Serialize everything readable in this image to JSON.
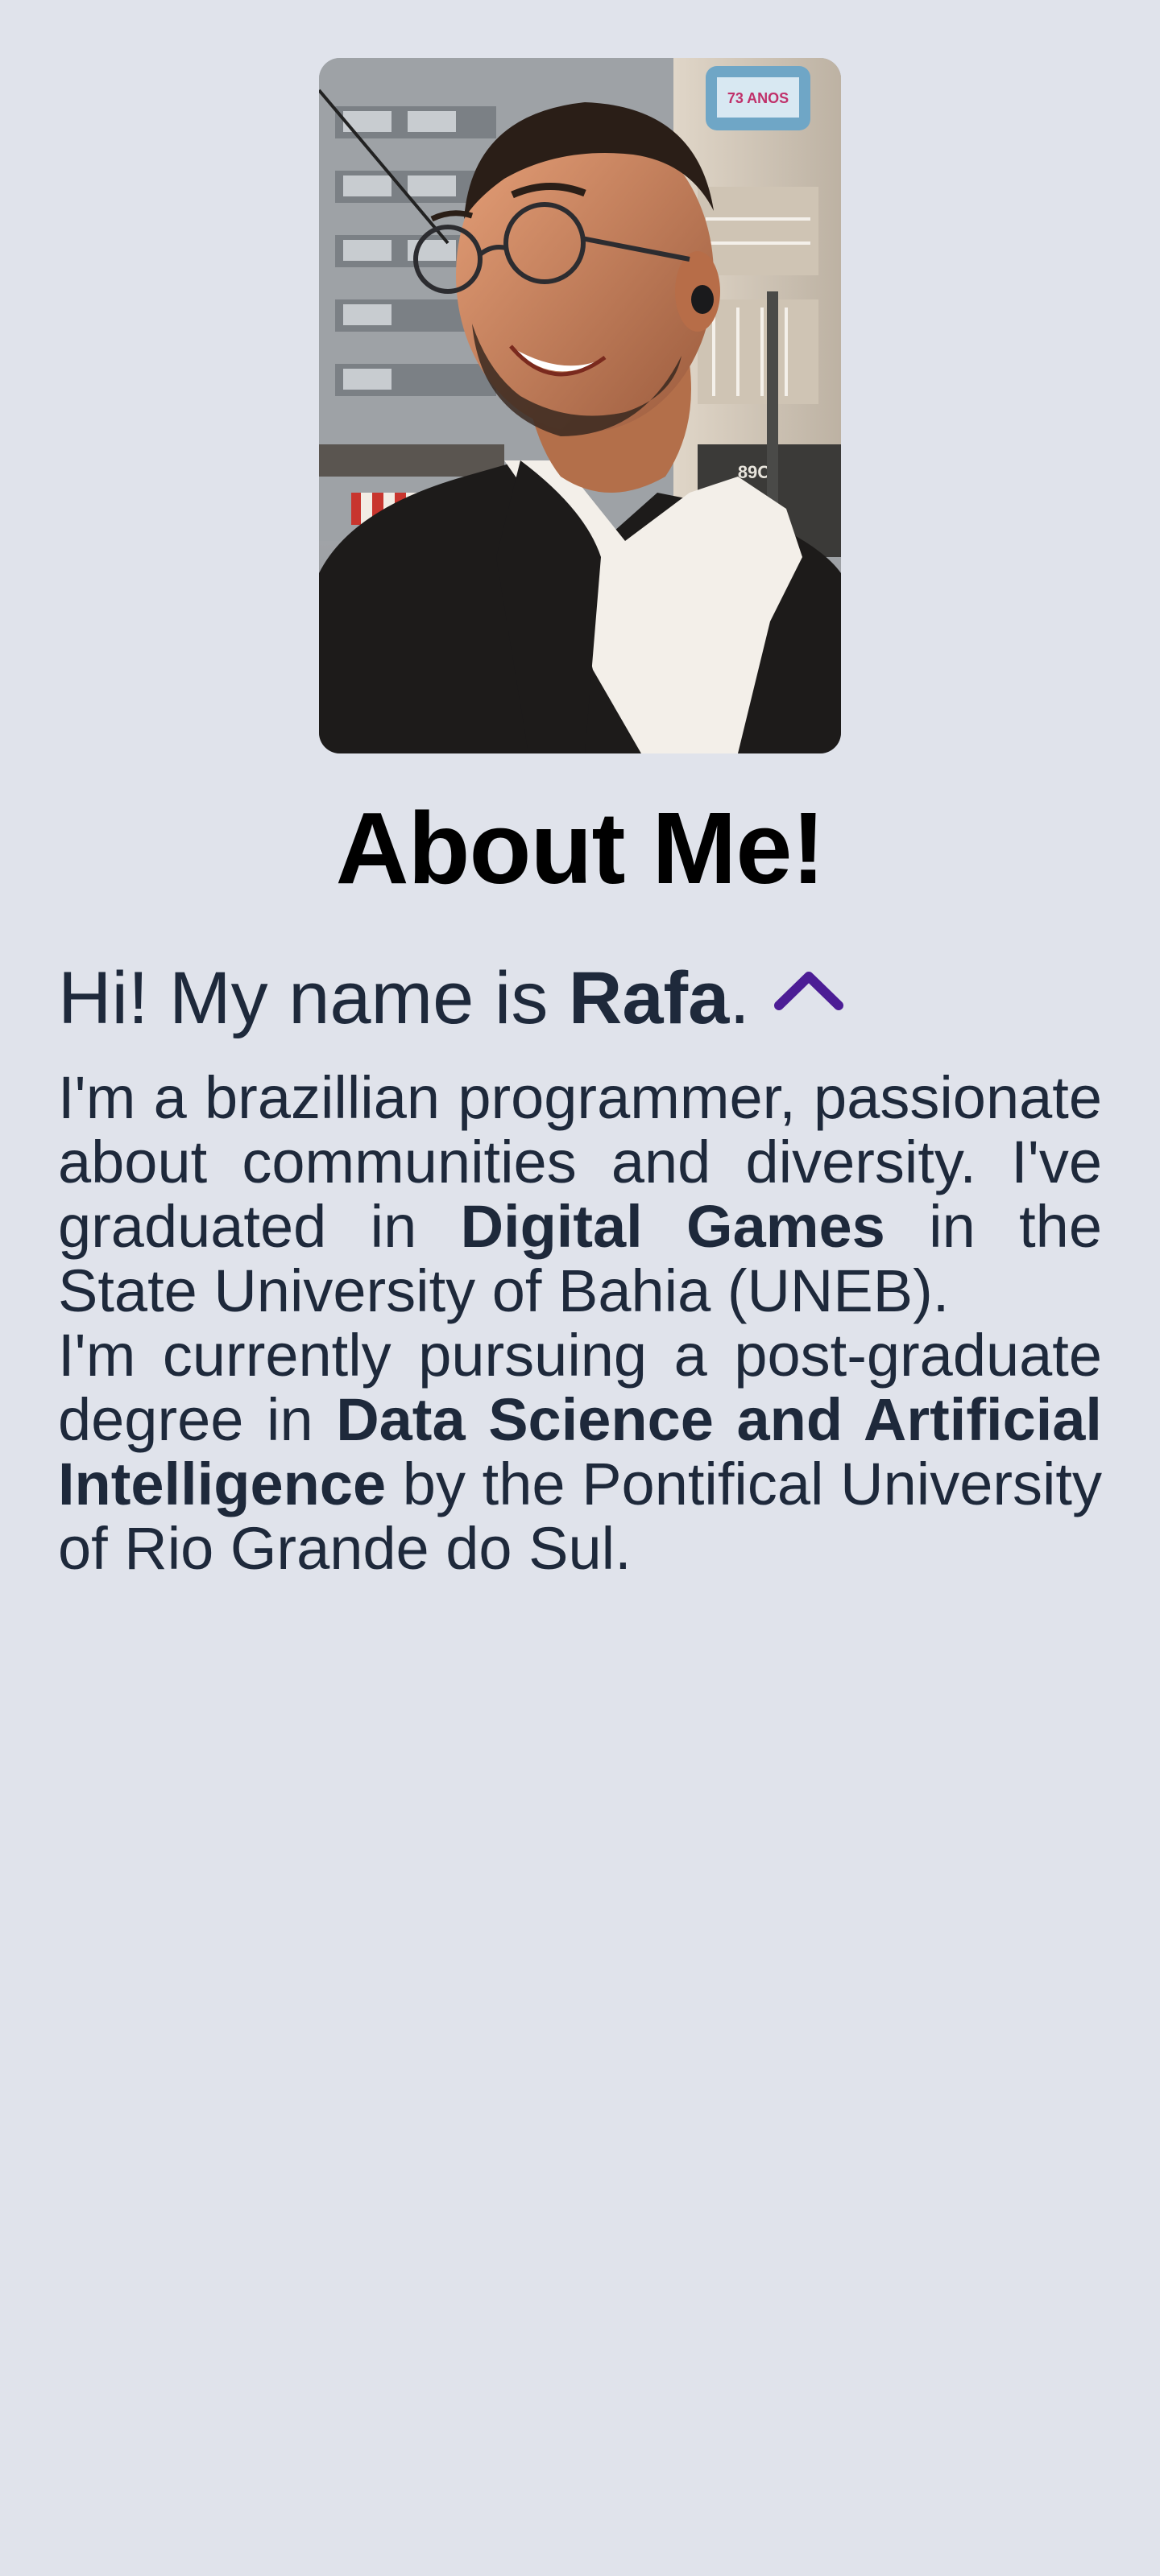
{
  "profile": {
    "photo_alt": "Rafa portrait",
    "photo_sign": "73 ANOS",
    "photo_storefront": "89C"
  },
  "title": "About Me!",
  "greeting": {
    "prefix": "Hi! My name is ",
    "name": "Rafa",
    "suffix": ".",
    "icon": "chevron-up-icon",
    "icon_color": "#4c1d95"
  },
  "bio": {
    "p1_a": "I'm a brazillian programmer, passionate about communities and diversity. I've graduated in ",
    "p1_b": "Digital Games",
    "p1_c": " in the State University of Bahia (UNEB).",
    "p2_a": "I'm currently pursuing a post-graduate degree in ",
    "p2_b": "Data Science and Artificial Intelligence",
    "p2_c": " by the Pontifical University of Rio Grande do Sul."
  },
  "colors": {
    "background": "#e0e3eb",
    "text": "#1e293b",
    "title": "#000000",
    "accent": "#4c1d95"
  }
}
